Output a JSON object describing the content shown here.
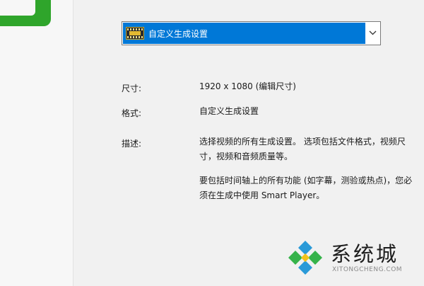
{
  "preset_dropdown": {
    "selected": "自定义生成设置",
    "icon": "film-icon",
    "chevron_icon": "chevron-down-icon"
  },
  "details": {
    "size_label": "尺寸:",
    "size_value": "1920 x 1080 (编辑尺寸)",
    "format_label": "格式:",
    "format_value": "自定义生成设置",
    "desc_label": "描述:",
    "desc_paragraph_1": "选择视频的所有生成设置。 选项包括文件格式，视频尺寸，视频和音频质量等。",
    "desc_paragraph_2": "要包括时间轴上的所有功能 (如字幕，测验或热点)，您必须在生成中使用 Smart Player。"
  },
  "watermark": {
    "title": "系统城",
    "subtitle": "XITONGCHENG.COM"
  },
  "colors": {
    "accent_green": "#2fa52b",
    "selection_blue": "#0078d7"
  }
}
